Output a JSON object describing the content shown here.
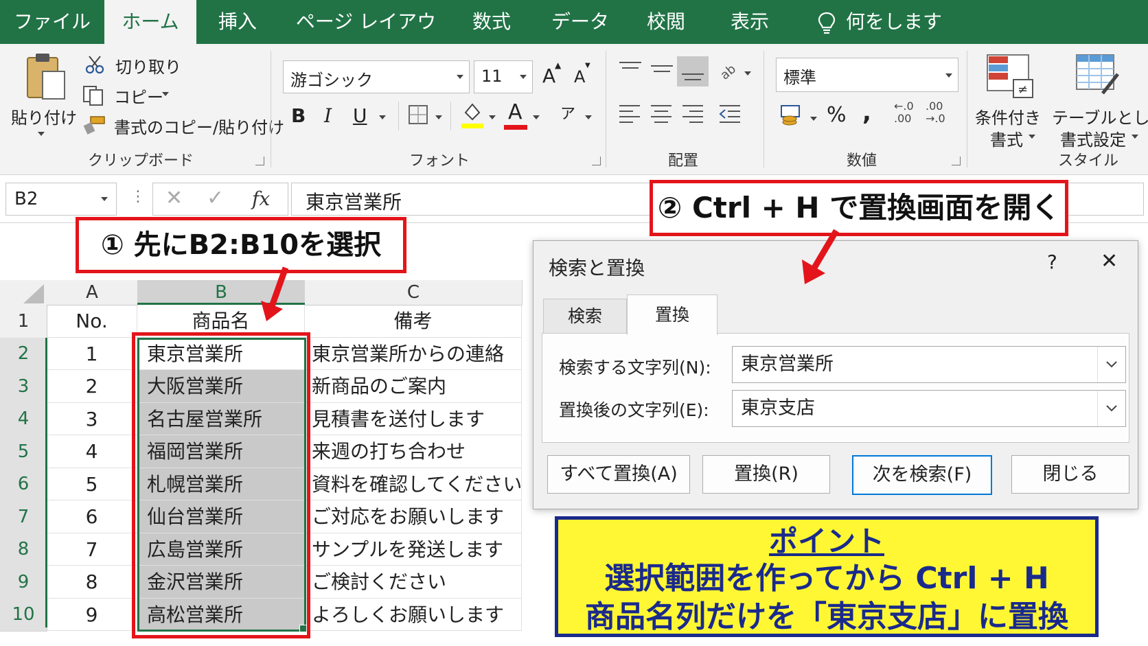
{
  "ribbon_tabs": [
    "ファイル",
    "ホーム",
    "挿入",
    "ページ レイアウト",
    "数式",
    "データ",
    "校閲",
    "表示"
  ],
  "active_tab": "ホーム",
  "tell_me": "何をしますか",
  "clipboard": {
    "paste": "貼り付け",
    "cut": "切り取り",
    "copy": "コピー",
    "format_painter": "書式のコピー/貼り付け",
    "label": "クリップボード"
  },
  "font": {
    "name": "游ゴシック",
    "size": "11",
    "bold": "B",
    "italic": "I",
    "underline": "U",
    "increase": "A",
    "decrease": "A",
    "label": "フォント"
  },
  "alignment": {
    "label": "配置"
  },
  "number": {
    "format": "標準",
    "percent": "%",
    "comma": ",",
    "label": "数値"
  },
  "styles": {
    "conditional_line1": "条件付き",
    "conditional_line2": "書式",
    "table_line1": "テーブルとして",
    "table_line2": "書式設定",
    "label": "スタイル"
  },
  "formula_bar": {
    "name_box": "B2",
    "fx": "fx",
    "content": "東京営業所"
  },
  "sheet": {
    "columns": [
      "A",
      "B",
      "C"
    ],
    "rows": [
      "1",
      "2",
      "3",
      "4",
      "5",
      "6",
      "7",
      "8",
      "9",
      "10"
    ],
    "cells": [
      [
        "No.",
        "商品名",
        "備考"
      ],
      [
        "1",
        "東京営業所",
        "東京営業所からの連絡"
      ],
      [
        "2",
        "大阪営業所",
        "新商品のご案内"
      ],
      [
        "3",
        "名古屋営業所",
        "見積書を送付します"
      ],
      [
        "4",
        "福岡営業所",
        "来週の打ち合わせ"
      ],
      [
        "5",
        "札幌営業所",
        "資料を確認してください"
      ],
      [
        "6",
        "仙台営業所",
        "ご対応をお願いします"
      ],
      [
        "7",
        "広島営業所",
        "サンプルを発送します"
      ],
      [
        "8",
        "金沢営業所",
        "ご検討ください"
      ],
      [
        "9",
        "高松営業所",
        "よろしくお願いします"
      ]
    ]
  },
  "dialog": {
    "title": "検索と置換",
    "help": "?",
    "close": "✕",
    "tabs": [
      "検索",
      "置換"
    ],
    "active_tab": "置換",
    "find_label": "検索する文字列(N):",
    "find_value": "東京営業所",
    "replace_label": "置換後の文字列(E):",
    "replace_value": "東京支店",
    "buttons": [
      "すべて置換(A)",
      "置換(R)",
      "次を検索(F)",
      "閉じる"
    ]
  },
  "callouts": {
    "step1": "① 先にB2:B10を選択",
    "step2": "② Ctrl + H で置換画面を開く",
    "point_title": "ポイント",
    "point_line1": "選択範囲を作ってから Ctrl + H",
    "point_line2": "商品名列だけを「東京支店」に置換"
  },
  "colors": {
    "excel_green": "#217346",
    "callout_red": "#e3151b",
    "point_yellow": "#fff733",
    "point_blue": "#1a2a8c"
  }
}
